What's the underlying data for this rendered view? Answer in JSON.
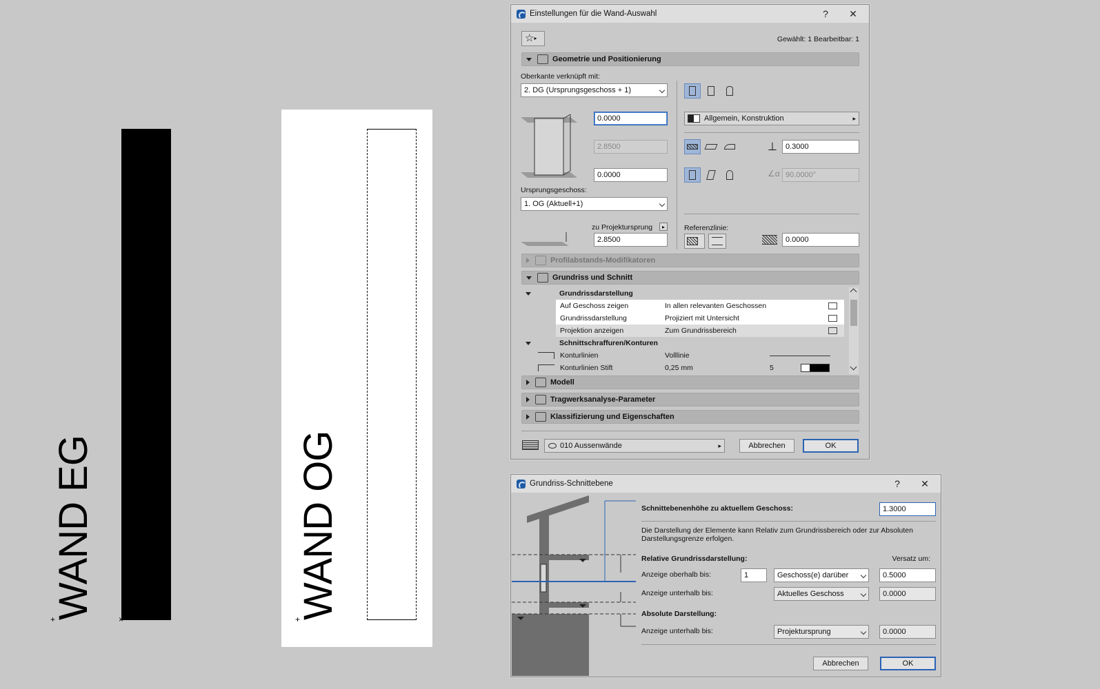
{
  "canvas": {
    "label_eg": "WAND EG",
    "label_og": "WAND OG"
  },
  "wall_dialog": {
    "title": "Einstellungen für die Wand-Auswahl",
    "help": "?",
    "close": "✕",
    "selection_info": "Gewählt: 1 Bearbeitbar: 1",
    "geometry": {
      "header": "Geometrie und Positionierung",
      "top_linked_label": "Oberkante verknüpft mit:",
      "top_linked_value": "2. DG (Ursprungsgeschoss + 1)",
      "top_offset": "0.0000",
      "height": "2.8500",
      "bottom_offset": "0.0000",
      "home_story_label": "Ursprungsgeschoss:",
      "home_story_value": "1. OG (Aktuell+1)",
      "to_project_zero_label": "zu Projektursprung",
      "project_zero_value": "2.8500",
      "building_material": "Allgemein, Konstruktion",
      "thickness": "0.3000",
      "angle": "90.0000°",
      "reference_line_label": "Referenzlinie:",
      "reference_offset": "0.0000"
    },
    "profile_modifiers": "Profilabstands-Modifikatoren",
    "floor_plan_section": {
      "header": "Grundriss und Schnitt",
      "group1": "Grundrissdarstellung",
      "rows": [
        {
          "name": "Auf Geschoss zeigen",
          "value": "In allen relevanten Geschossen"
        },
        {
          "name": "Grundrissdarstellung",
          "value": "Projiziert mit Untersicht"
        },
        {
          "name": "Projektion anzeigen",
          "value": "Zum Grundrissbereich"
        }
      ],
      "group2": "Schnittschraffuren/Konturen",
      "row4_name": "Konturlinien",
      "row4_value": "Volllinie",
      "row5_name": "Konturlinien Stift",
      "row5_value": "0,25 mm",
      "row5_num": "5"
    },
    "model": "Modell",
    "structural": "Tragwerksanalyse-Parameter",
    "classification": "Klassifizierung und Eigenschaften",
    "layer": "010 Aussenwände",
    "cancel": "Abbrechen",
    "ok": "OK"
  },
  "cut_dialog": {
    "title": "Grundriss-Schnittebene",
    "help": "?",
    "close": "✕",
    "cut_height_label": "Schnittebenenhöhe zu aktuellem Geschoss:",
    "cut_height_value": "1.3000",
    "description": "Die Darstellung der Elemente kann Relativ zum Grundrissbereich oder zur Absoluten Darstellungsgrenze erfolgen.",
    "relative_label": "Relative Grundrissdarstellung:",
    "offset_label": "Versatz um:",
    "above_label": "Anzeige oberhalb bis:",
    "above_count": "1",
    "above_select": "Geschoss(e) darüber",
    "above_offset": "0.5000",
    "below_label": "Anzeige unterhalb bis:",
    "below_select": "Aktuelles Geschoss",
    "below_offset": "0.0000",
    "absolute_label": "Absolute Darstellung:",
    "abs_below_label": "Anzeige unterhalb bis:",
    "abs_below_select": "Projektursprung",
    "abs_below_offset": "0.0000",
    "cancel": "Abbrechen",
    "ok": "OK"
  }
}
